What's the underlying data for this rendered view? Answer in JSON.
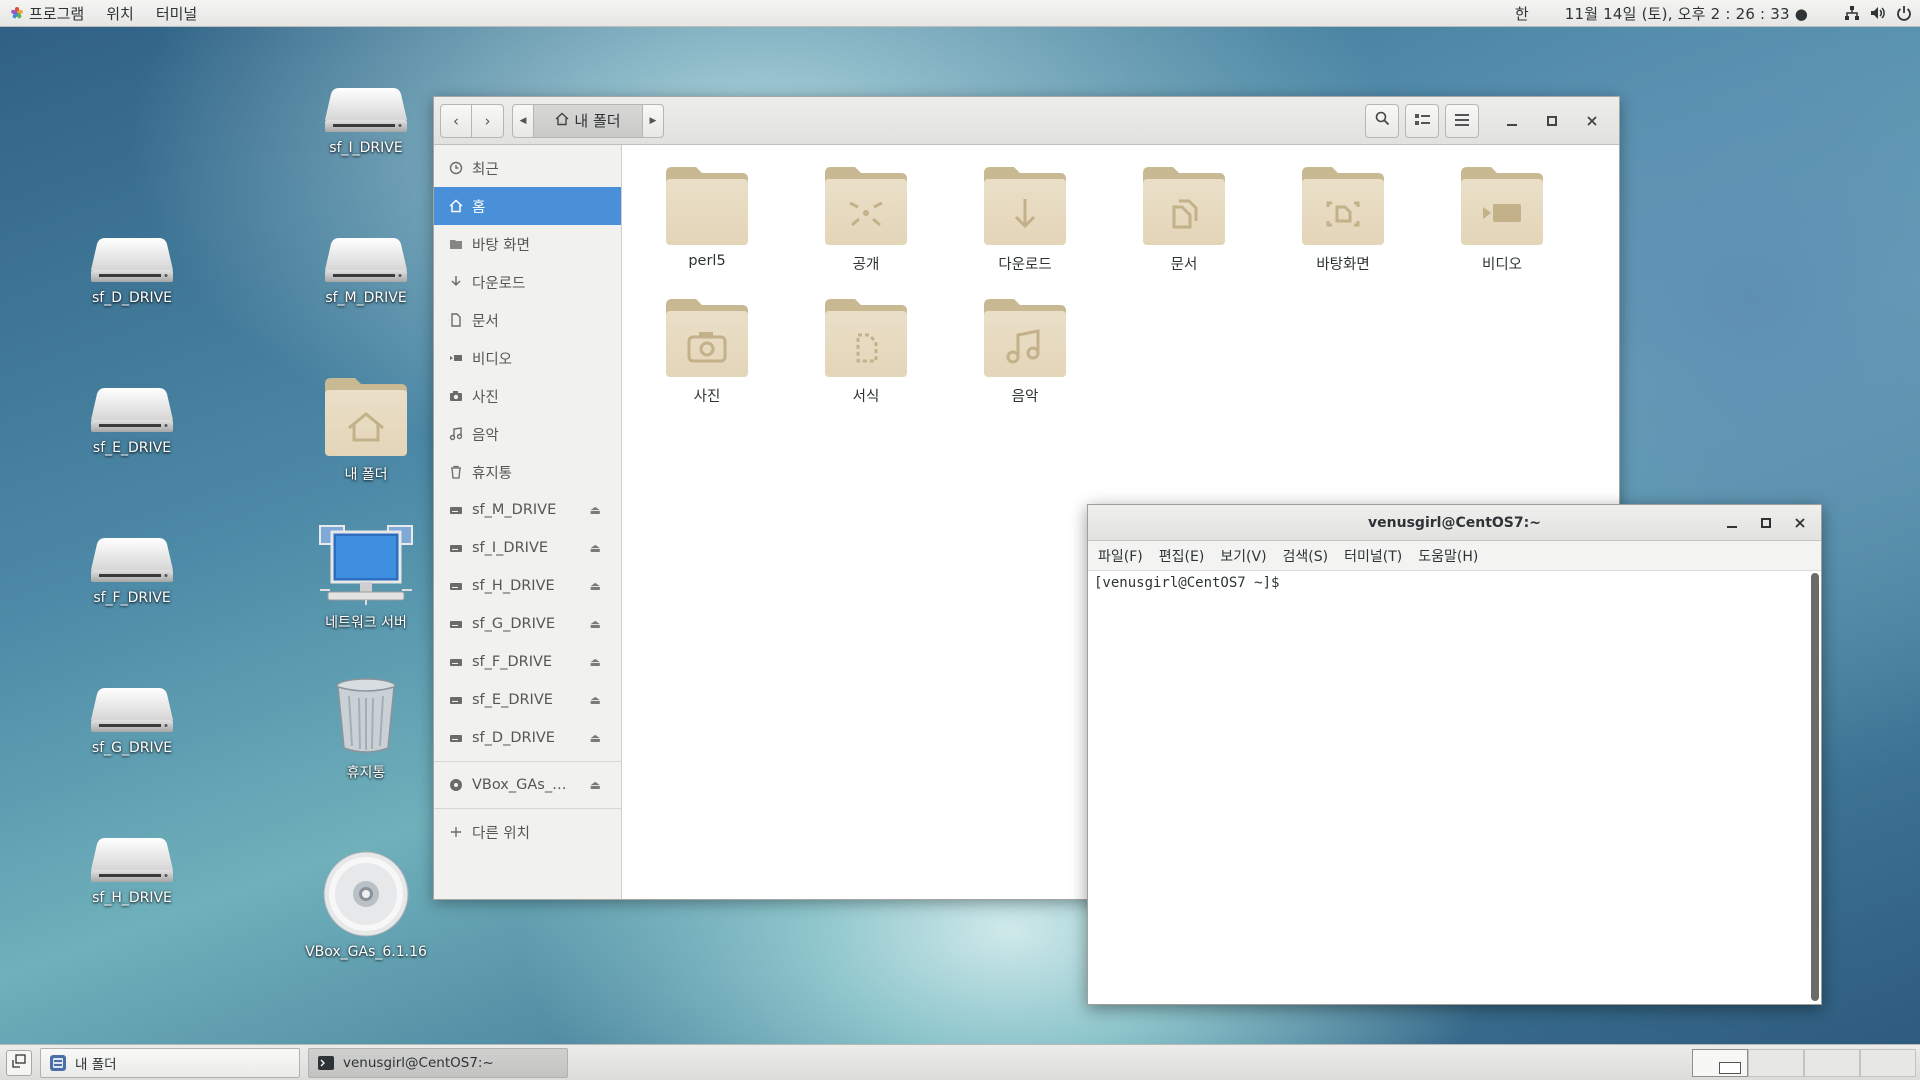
{
  "topbar": {
    "menus": [
      "프로그램",
      "위치",
      "터미널"
    ],
    "ime": "한",
    "clock": "11월 14일 (토), 오후  2 : 26 : 33 ●"
  },
  "desktop": {
    "icons": [
      {
        "label": "sf_I_DRIVE"
      },
      {
        "label": "sf_D_DRIVE"
      },
      {
        "label": "sf_M_DRIVE"
      },
      {
        "label": "sf_E_DRIVE"
      },
      {
        "label": "내 폴더"
      },
      {
        "label": "sf_F_DRIVE"
      },
      {
        "label": "네트워크 서버"
      },
      {
        "label": "sf_G_DRIVE"
      },
      {
        "label": "휴지통"
      },
      {
        "label": "sf_H_DRIVE"
      },
      {
        "label": "VBox_GAs_6.1.16"
      }
    ]
  },
  "filemanager": {
    "path": "내 폴더",
    "sidebar": [
      {
        "label": "최근",
        "icon": "clock-icon"
      },
      {
        "label": "홈",
        "icon": "home-icon"
      },
      {
        "label": "바탕 화면",
        "icon": "desktop-folder-icon"
      },
      {
        "label": "다운로드",
        "icon": "download-icon"
      },
      {
        "label": "문서",
        "icon": "document-icon"
      },
      {
        "label": "비디오",
        "icon": "video-icon"
      },
      {
        "label": "사진",
        "icon": "camera-icon"
      },
      {
        "label": "음악",
        "icon": "music-icon"
      },
      {
        "label": "휴지통",
        "icon": "trash-icon"
      },
      {
        "label": "sf_M_DRIVE",
        "icon": "drive-icon"
      },
      {
        "label": "sf_I_DRIVE",
        "icon": "drive-icon"
      },
      {
        "label": "sf_H_DRIVE",
        "icon": "drive-icon"
      },
      {
        "label": "sf_G_DRIVE",
        "icon": "drive-icon"
      },
      {
        "label": "sf_F_DRIVE",
        "icon": "drive-icon"
      },
      {
        "label": "sf_E_DRIVE",
        "icon": "drive-icon"
      },
      {
        "label": "sf_D_DRIVE",
        "icon": "drive-icon"
      },
      {
        "label": "VBox_GAs_…",
        "icon": "disc-icon"
      },
      {
        "label": "다른 위치",
        "icon": "plus-icon"
      }
    ],
    "folders": [
      {
        "label": "perl5",
        "emblem": "none"
      },
      {
        "label": "공개",
        "emblem": "share"
      },
      {
        "label": "다운로드",
        "emblem": "download"
      },
      {
        "label": "문서",
        "emblem": "document"
      },
      {
        "label": "바탕화면",
        "emblem": "desktop"
      },
      {
        "label": "비디오",
        "emblem": "video"
      },
      {
        "label": "사진",
        "emblem": "camera"
      },
      {
        "label": "서식",
        "emblem": "template"
      },
      {
        "label": "음악",
        "emblem": "music"
      }
    ]
  },
  "terminal": {
    "title": "venusgirl@CentOS7:~",
    "menus": [
      "파일(F)",
      "편집(E)",
      "보기(V)",
      "검색(S)",
      "터미널(T)",
      "도움말(H)"
    ],
    "prompt": "[venusgirl@CentOS7 ~]$ "
  },
  "taskbar": {
    "tasks": [
      {
        "label": "내 폴더"
      },
      {
        "label": "venusgirl@CentOS7:~"
      }
    ]
  },
  "colors": {
    "accent": "#4a90d9",
    "folder": "#c8b58f"
  }
}
